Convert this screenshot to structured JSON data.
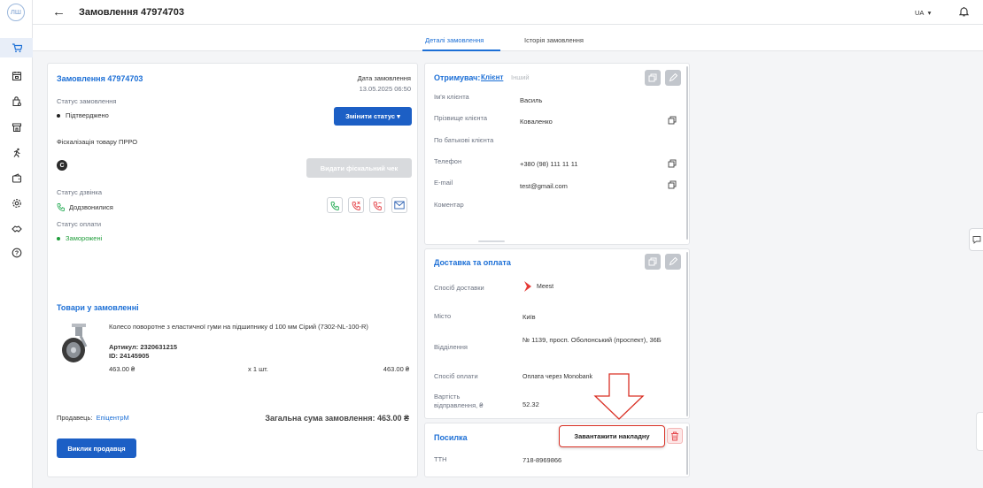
{
  "app": {
    "logo_text": "ЛШ"
  },
  "sidebar": {
    "icons": [
      "cart-icon",
      "calendar-icon",
      "bag-search-icon",
      "store-icon",
      "runner-icon",
      "wallet-icon",
      "settings-icon",
      "handshake-icon",
      "help-icon"
    ],
    "active_index": 0
  },
  "header": {
    "back_symbol": "←",
    "title": "Замовлення 47974703",
    "lang": "UA",
    "lang_caret": "▾"
  },
  "tabs": [
    {
      "label": "Деталі замовлення",
      "active": true
    },
    {
      "label": "Історія замовлення",
      "active": false
    }
  ],
  "order": {
    "title": "Замовлення 47974703",
    "date_label": "Дата замовлення",
    "date_value": "13.05.2025 06:50",
    "status_label": "Статус замовлення",
    "status_value": "Підтверджено",
    "change_status_button": "Змінити статус",
    "fiscal_label": "Фіскалізація товару ПРРО",
    "fiscal_badge": "С",
    "fiscal_button": "Видати фіскальний чек",
    "call_status_label": "Статус дзвінка",
    "call_status_value": "Додзвонилися",
    "payment_status_label": "Статус оплати",
    "payment_status_value": "Заморожені"
  },
  "products": {
    "title": "Товари у замовленні",
    "item": {
      "name": "Колесо поворотне з еластичної гуми на підшипнику d 100 мм Сірий (7302-NL-100-R)",
      "article_label": "Артикул:",
      "article": "2320631215",
      "id_label": "ID:",
      "id": "24145905",
      "price": "463.00 ₴",
      "qty": "x 1 шт.",
      "total": "463.00 ₴"
    },
    "seller_label": "Продавець:",
    "seller": "ЕпіцентрМ",
    "total_label": "Загальна сума замовлення:",
    "total_value": "463.00 ₴",
    "call_seller_button": "Виклик продавця"
  },
  "recipient": {
    "title": "Отримувач:",
    "type_client": "Клієнт",
    "type_other": "Інший",
    "rows": [
      {
        "label": "Ім'я клієнта",
        "value": "Василь",
        "copy": false
      },
      {
        "label": "Прізвище клієнта",
        "value": "Коваленко",
        "copy": true
      },
      {
        "label": "По батькові клієнта",
        "value": "",
        "copy": false
      },
      {
        "label": "Телефон",
        "value": "+380 (98) 111 11 11",
        "copy": true
      },
      {
        "label": "E-mail",
        "value": "test@gmail.com",
        "copy": true
      },
      {
        "label": "Коментар",
        "value": "",
        "copy": false
      }
    ]
  },
  "delivery": {
    "title": "Доставка та оплата",
    "rows": [
      {
        "label": "Спосіб доставки",
        "value": "Meest"
      },
      {
        "label": "Місто",
        "value": "Київ"
      },
      {
        "label": "Відділення",
        "value": "№ 1139, просп. Оболонський (проспект), 36Б"
      },
      {
        "label": "Спосіб оплати",
        "value": "Оплата через Monobank"
      },
      {
        "label": "Вартість відправлення, ₴",
        "value": "52.32"
      }
    ]
  },
  "parcel": {
    "title": "Посилка",
    "download_button": "Завантажити накладну",
    "ttn_label": "ТТН",
    "ttn_value": "718-8969866"
  },
  "colors": {
    "accent": "#1c6fd6",
    "primary_button": "#1c5fc5",
    "status_dot": "#222222",
    "payment_green": "#1f9d3a",
    "call_green": "#2cae5a",
    "call_red": "#e5484d",
    "mail_blue": "#2a5fb0",
    "annotation_red": "#d93025"
  }
}
